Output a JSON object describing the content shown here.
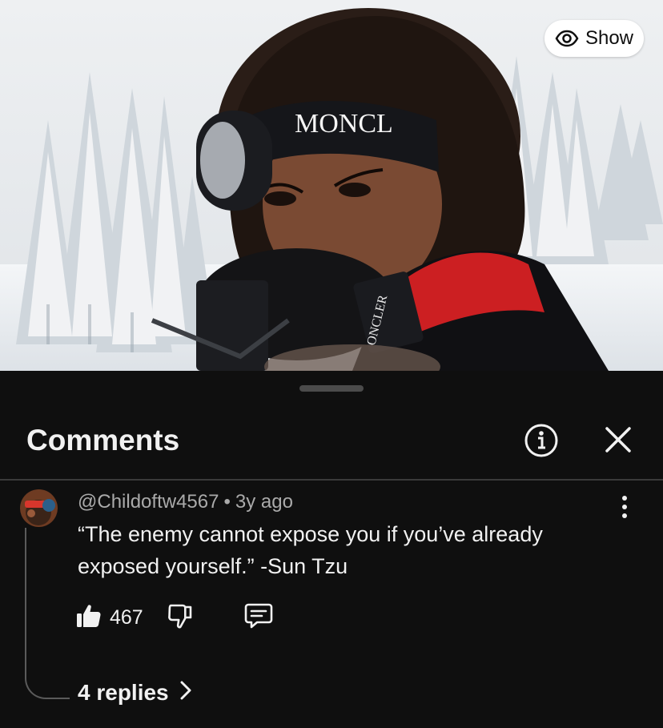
{
  "video": {
    "show_button_label": "Show",
    "headband_text": "MONCL",
    "mic_text": "ONCLER"
  },
  "comments_panel": {
    "title": "Comments"
  },
  "comment": {
    "author": "@Childoftw4567",
    "separator": "•",
    "time_ago": "3y ago",
    "text": "“The enemy cannot expose you if you’ve already exposed yourself.” -Sun Tzu",
    "like_count": "467",
    "replies_label": "4 replies"
  },
  "icons": {
    "show": "eye-icon",
    "info": "info-icon",
    "close": "close-icon",
    "more": "kebab-menu-icon",
    "like": "thumbs-up-icon",
    "dislike": "thumbs-down-icon",
    "reply": "reply-icon",
    "replies": "chevron-right-icon"
  },
  "colors": {
    "background": "#0f0f0f",
    "text_primary": "#f1f1f1",
    "text_secondary": "#aaaaaa",
    "divider": "#3a3a3a"
  }
}
